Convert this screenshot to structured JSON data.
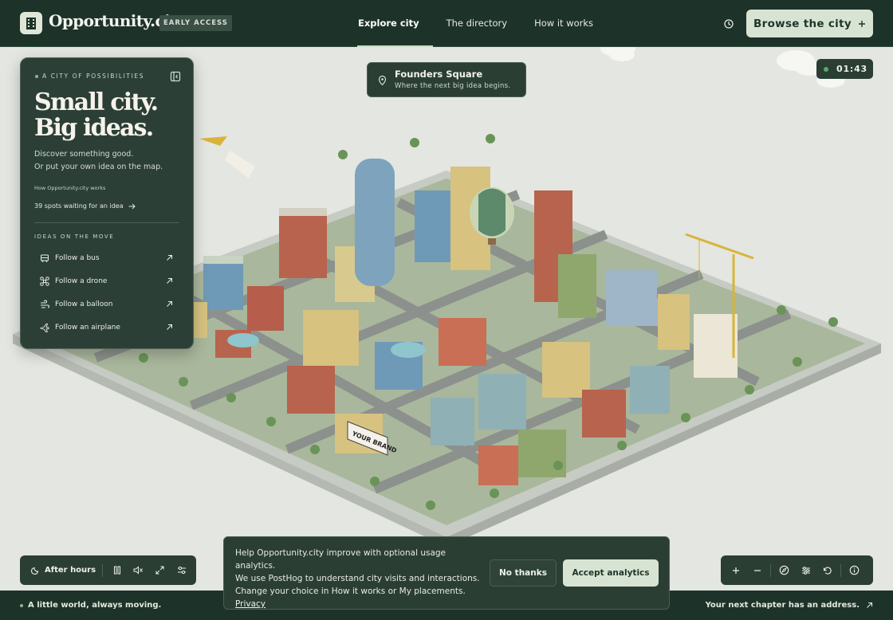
{
  "header": {
    "logo_text": "Opportunity.city",
    "badge": "EARLY ACCESS",
    "nav": [
      {
        "label": "Explore city",
        "active": true
      },
      {
        "label": "The directory",
        "active": false
      },
      {
        "label": "How it works",
        "active": false
      }
    ],
    "cta_label": "Browse  the city",
    "cta_icon": "plus-icon"
  },
  "panel": {
    "eyebrow": "A CITY OF POSSIBILITIES",
    "title_line1": "Small city.",
    "title_line2": "Big ideas.",
    "desc_line1": "Discover something good.",
    "desc_line2": "Or put your own idea on the map.",
    "how_link": "How Opportunity.city works",
    "spots_link": "39 spots waiting for an idea",
    "section_label": "IDEAS ON THE MOVE",
    "follow_items": [
      {
        "label": "Follow a bus",
        "icon": "bus-icon"
      },
      {
        "label": "Follow a drone",
        "icon": "drone-icon"
      },
      {
        "label": "Follow a balloon",
        "icon": "balloon-icon"
      },
      {
        "label": "Follow an airplane",
        "icon": "airplane-icon"
      }
    ]
  },
  "location": {
    "title": "Founders Square",
    "subtitle": "Where the next big idea begins."
  },
  "timer": {
    "value": "01:43"
  },
  "map_labels": {
    "billboard": "YOUR BRAND"
  },
  "bottom_left": {
    "mode_label": "After hours"
  },
  "consent": {
    "line1": "Help Opportunity.city improve with optional usage analytics.",
    "line2": "We use PostHog to understand city visits and interactions.",
    "line3": "Change your choice in How it works or My placements.",
    "privacy_label": "Privacy",
    "decline_label": "No thanks",
    "accept_label": "Accept analytics"
  },
  "footer": {
    "left_text": "A little world, always moving.",
    "right_text": "Your next chapter has an address."
  },
  "colors": {
    "nav_bg": "#1d3329",
    "panel_bg": "#2c3f36",
    "accent": "#d8e4d3",
    "status_green": "#4fb067",
    "map_bg": "#e4e6e1"
  }
}
